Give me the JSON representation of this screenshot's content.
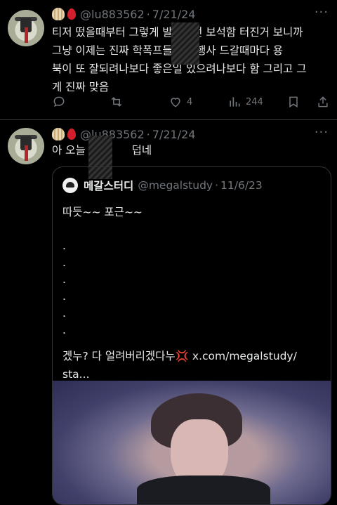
{
  "tweet1": {
    "handle": "@lu883562",
    "separator": "·",
    "date": "7/21/24",
    "more": "···",
    "lines": [
      "티저 떴을때부터 그렇게 발작하던 보석함 터진거 보니까",
      "그냥 이제는 진짜 학폭프들 연례행사 드갈때마다 용",
      "북이 또 잘되려나보다 좋은일 있으려나보다 함 그리고 그",
      "게 진짜 맞음"
    ],
    "actions": {
      "reply_count": "",
      "retweet_count": "",
      "like_count": "4",
      "view_count": "244"
    }
  },
  "tweet2": {
    "handle": "@lu883562",
    "separator": "·",
    "date": "7/21/24",
    "text_start": "아 오늘",
    "text_end": "덥네",
    "quote": {
      "name": "메갈스터디",
      "handle": "@megalstudy",
      "separator": "·",
      "date": "11/6/23",
      "lines": [
        "따듯~~ 포근~~",
        "",
        ".",
        ".",
        ".",
        ".",
        ".",
        ".",
        "",
        "겠누? 다 얼려버리겠다누💢 x.com/megalstudy/",
        "sta..."
      ]
    }
  },
  "colors": {
    "background": "#000000",
    "text": "#e7e9ea",
    "muted": "#71767b",
    "border": "#2f3336"
  }
}
